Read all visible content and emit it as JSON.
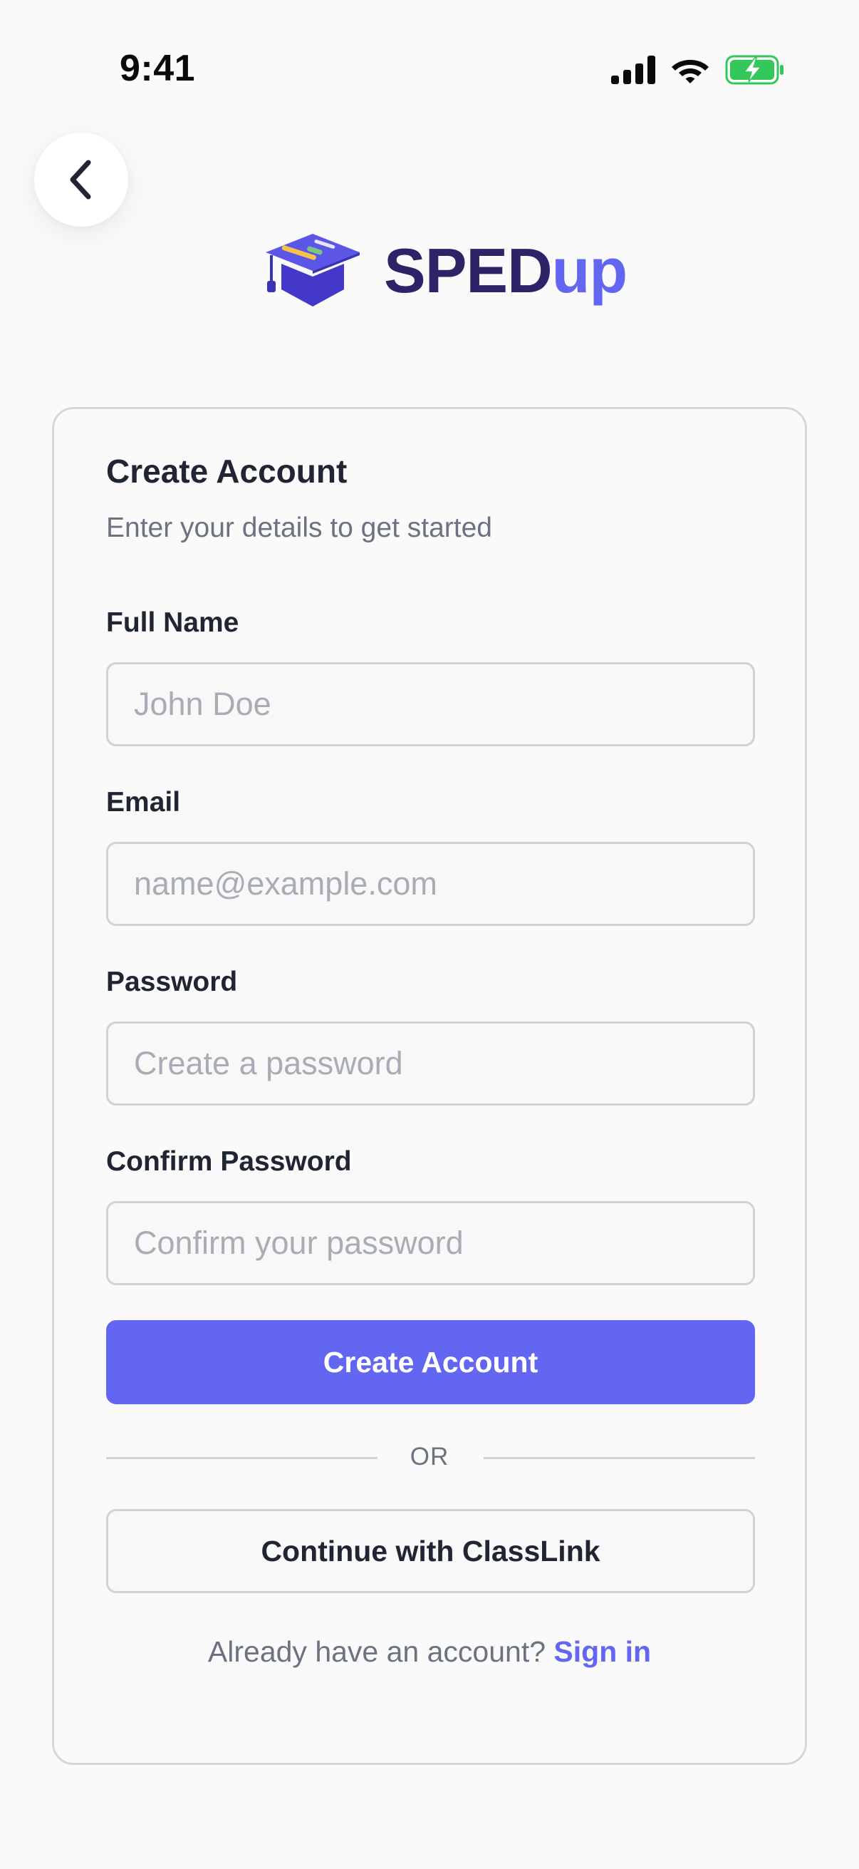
{
  "status_bar": {
    "time": "9:41",
    "icons": [
      "cellular-signal-icon",
      "wifi-icon",
      "battery-charging-icon"
    ]
  },
  "nav": {
    "back_icon": "chevron-left-icon"
  },
  "logo": {
    "text_part1": "SPED",
    "text_part2": "up",
    "icon": "graduation-cap-icon"
  },
  "form": {
    "title": "Create Account",
    "subtitle": "Enter your details to get started",
    "fields": [
      {
        "label": "Full Name",
        "placeholder": "John Doe",
        "value": ""
      },
      {
        "label": "Email",
        "placeholder": "name@example.com",
        "value": ""
      },
      {
        "label": "Password",
        "placeholder": "Create a password",
        "value": ""
      },
      {
        "label": "Confirm Password",
        "placeholder": "Confirm your password",
        "value": ""
      }
    ],
    "submit_label": "Create Account",
    "divider_text": "OR",
    "classlink_label": "Continue with ClassLink",
    "signin_prompt": "Already have an account?",
    "signin_link": "Sign in"
  },
  "colors": {
    "accent": "#6366f1",
    "brand_dark": "#2c2466",
    "text_primary": "#1f2533",
    "text_secondary": "#6b7280",
    "battery_green": "#34c759"
  }
}
